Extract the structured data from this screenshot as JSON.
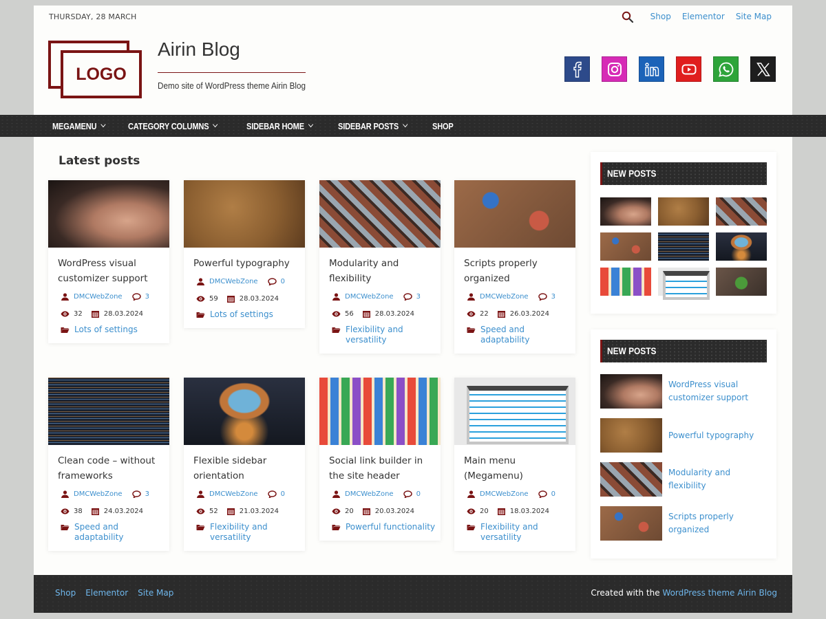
{
  "header": {
    "date": "THURSDAY, 28 MARCH",
    "top_links": [
      "Shop",
      "Elementor",
      "Site Map"
    ],
    "logo_text": "LOGO",
    "site_title": "Airin Blog",
    "tagline": "Demo site of WordPress theme Airin Blog",
    "social": [
      {
        "name": "facebook",
        "color": "#2d4a8a"
      },
      {
        "name": "instagram",
        "color": "#d62bb6"
      },
      {
        "name": "linkedin",
        "color": "#1c63b8"
      },
      {
        "name": "youtube",
        "color": "#e01e1e"
      },
      {
        "name": "whatsapp",
        "color": "#2ea43a"
      },
      {
        "name": "x",
        "color": "#1e1e1e"
      }
    ]
  },
  "nav": {
    "items": [
      {
        "label": "MEGAMENU",
        "has_submenu": true
      },
      {
        "label": "CATEGORY COLUMNS",
        "has_submenu": true
      },
      {
        "label": "SIDEBAR HOME",
        "has_submenu": true
      },
      {
        "label": "SIDEBAR POSTS",
        "has_submenu": true
      },
      {
        "label": "SHOP",
        "has_submenu": false
      }
    ]
  },
  "main": {
    "title": "Latest posts",
    "posts": [
      {
        "title": "WordPress visual customizer support",
        "author": "DMCWebZone",
        "comments": "3",
        "views": "32",
        "date": "28.03.2024",
        "category": "Lots of settings",
        "thumb": "face"
      },
      {
        "title": "Powerful typography",
        "author": "DMCWebZone",
        "comments": "0",
        "views": "59",
        "date": "28.03.2024",
        "category": "Lots of settings",
        "thumb": "thanks"
      },
      {
        "title": "Modularity and flexibility",
        "author": "DMCWebZone",
        "comments": "3",
        "views": "56",
        "date": "28.03.2024",
        "category": "Flexibility and versatility",
        "thumb": "build"
      },
      {
        "title": "Scripts properly organized",
        "author": "DMCWebZone",
        "comments": "3",
        "views": "22",
        "date": "26.03.2024",
        "category": "Speed and adaptability",
        "thumb": "tools"
      },
      {
        "title": "Clean code – without frameworks",
        "author": "DMCWebZone",
        "comments": "3",
        "views": "38",
        "date": "24.03.2024",
        "category": "Speed and adaptability",
        "thumb": "code"
      },
      {
        "title": "Flexible sidebar orientation",
        "author": "DMCWebZone",
        "comments": "0",
        "views": "52",
        "date": "21.03.2024",
        "category": "Flexibility and versatility",
        "thumb": "mush"
      },
      {
        "title": "Social link builder in the site header",
        "author": "DMCWebZone",
        "comments": "0",
        "views": "20",
        "date": "20.03.2024",
        "category": "Powerful functionality",
        "thumb": "icons"
      },
      {
        "title": "Main menu (Megamenu)",
        "author": "DMCWebZone",
        "comments": "0",
        "views": "20",
        "date": "18.03.2024",
        "category": "Flexibility and versatility",
        "thumb": "menu"
      }
    ]
  },
  "sidebar": {
    "widget1": {
      "title": "NEW POSTS",
      "thumbs": [
        "face",
        "thanks",
        "build",
        "tools",
        "code",
        "mush",
        "icons",
        "menu",
        "android"
      ]
    },
    "widget2": {
      "title": "NEW POSTS",
      "items": [
        {
          "title": "WordPress visual customizer support",
          "thumb": "face"
        },
        {
          "title": "Powerful typography",
          "thumb": "thanks"
        },
        {
          "title": "Modularity and flexibility",
          "thumb": "build"
        },
        {
          "title": "Scripts properly organized",
          "thumb": "tools"
        }
      ]
    }
  },
  "footer": {
    "links": [
      "Shop",
      "Elementor",
      "Site Map"
    ],
    "credit_prefix": "Created with the ",
    "credit_link": "WordPress theme Airin Blog"
  },
  "colors": {
    "accent": "#7a1414",
    "link": "#3c8fcd",
    "dark_bar": "#2b2b2b"
  }
}
